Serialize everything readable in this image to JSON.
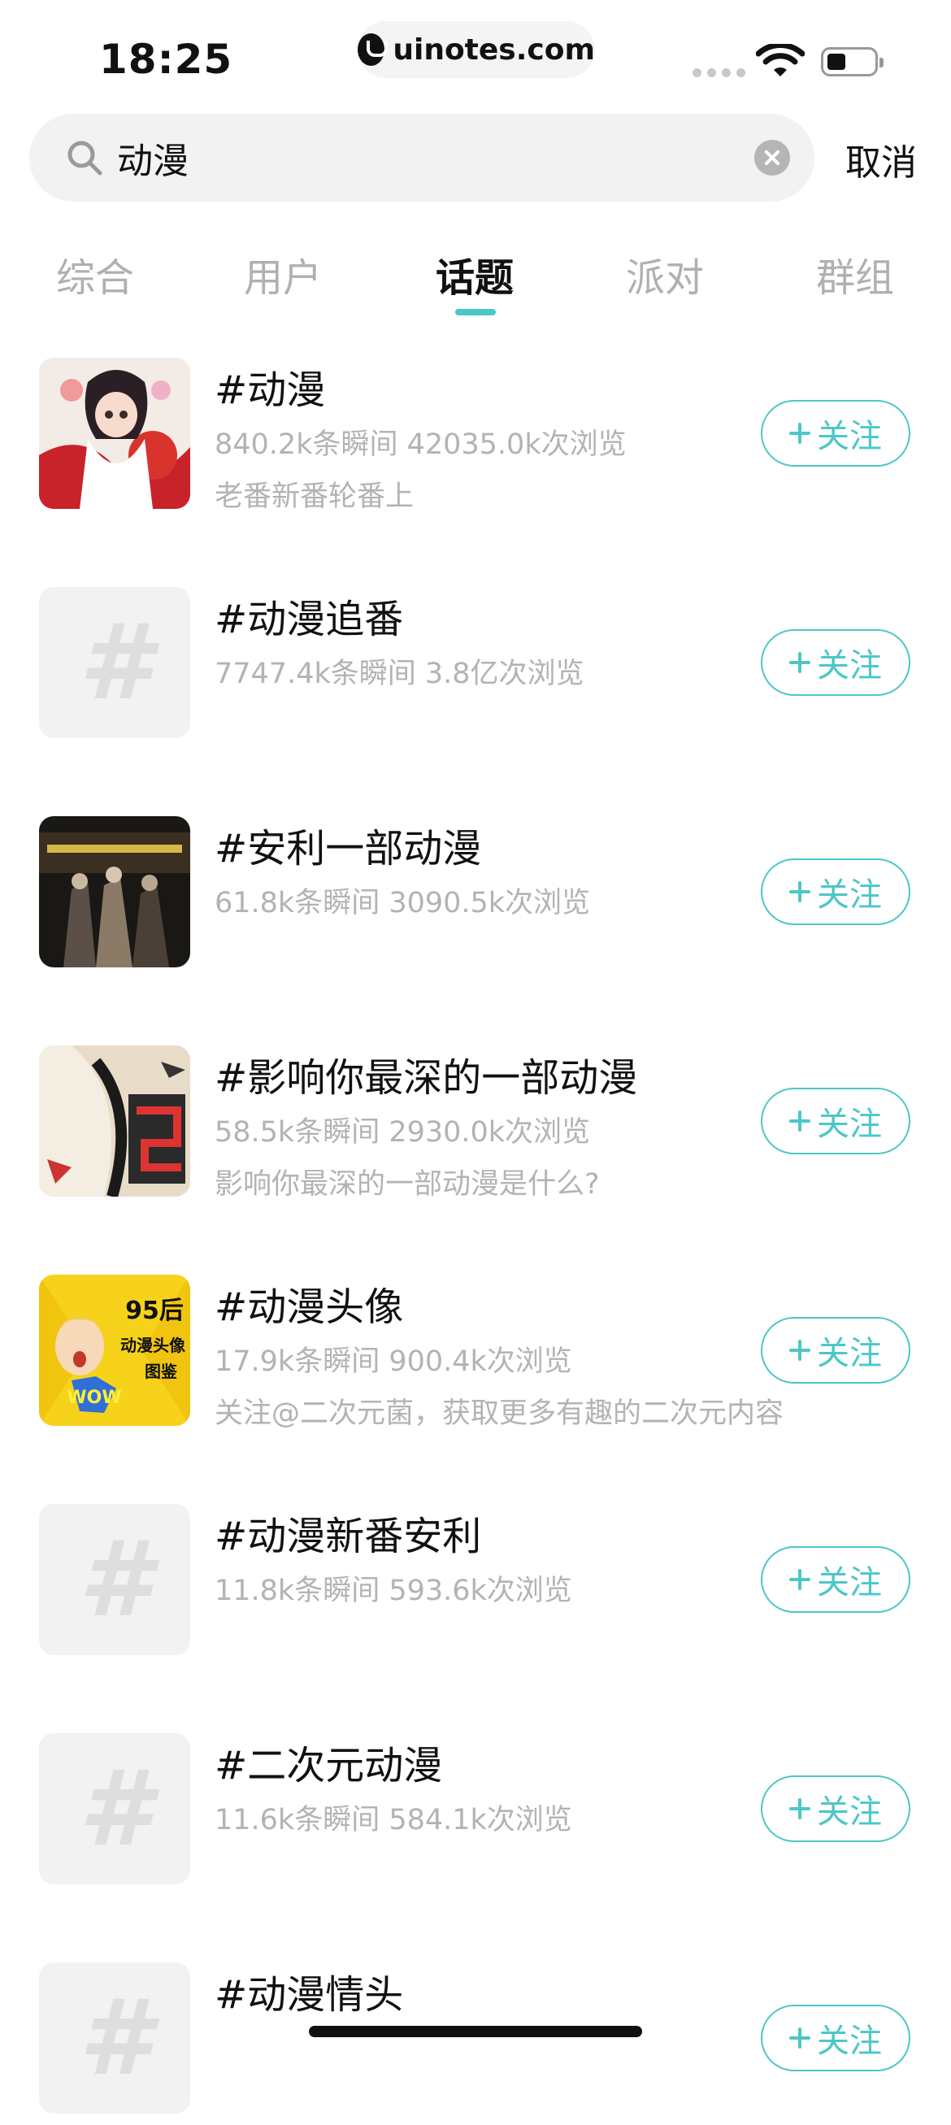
{
  "status_bar": {
    "time": "18:25",
    "url": "uinotes.com"
  },
  "search": {
    "query": "动漫",
    "cancel_label": "取消"
  },
  "tabs": [
    {
      "label": "综合",
      "active": false
    },
    {
      "label": "用户",
      "active": false
    },
    {
      "label": "话题",
      "active": true
    },
    {
      "label": "派对",
      "active": false
    },
    {
      "label": "群组",
      "active": false
    }
  ],
  "topics": [
    {
      "title": "#动漫",
      "stats": "840.2k条瞬间 42035.0k次浏览",
      "desc": "老番新番轮番上",
      "thumb": "anime-girl-art",
      "follow_label": "关注"
    },
    {
      "title": "#动漫追番",
      "stats": "7747.4k条瞬间 3.8亿次浏览",
      "desc": "",
      "thumb": "hash-placeholder",
      "follow_label": "关注"
    },
    {
      "title": "#安利一部动漫",
      "stats": "61.8k条瞬间 3090.5k次浏览",
      "desc": "",
      "thumb": "dark-poster",
      "follow_label": "关注"
    },
    {
      "title": "#影响你最深的一部动漫",
      "stats": "58.5k条瞬间 2930.0k次浏览",
      "desc": "影响你最深的一部动漫是什么?",
      "thumb": "graffiti-art",
      "follow_label": "关注"
    },
    {
      "title": "#动漫头像",
      "stats": "17.9k条瞬间 900.4k次浏览",
      "desc": "关注@二次元菌，获取更多有趣的二次元内容",
      "thumb": "comic-wow",
      "thumb_text": [
        "95后",
        "动漫头像",
        "图鉴",
        "WOW"
      ],
      "follow_label": "关注"
    },
    {
      "title": "#动漫新番安利",
      "stats": "11.8k条瞬间 593.6k次浏览",
      "desc": "",
      "thumb": "hash-placeholder",
      "follow_label": "关注"
    },
    {
      "title": "#二次元动漫",
      "stats": "11.6k条瞬间 584.1k次浏览",
      "desc": "",
      "thumb": "hash-placeholder",
      "follow_label": "关注"
    },
    {
      "title": "#动漫情头",
      "stats": "",
      "desc": "",
      "thumb": "hash-placeholder",
      "follow_label": "关注"
    }
  ],
  "colors": {
    "accent": "#4cc7c7",
    "muted_text": "#b3b3b3"
  }
}
